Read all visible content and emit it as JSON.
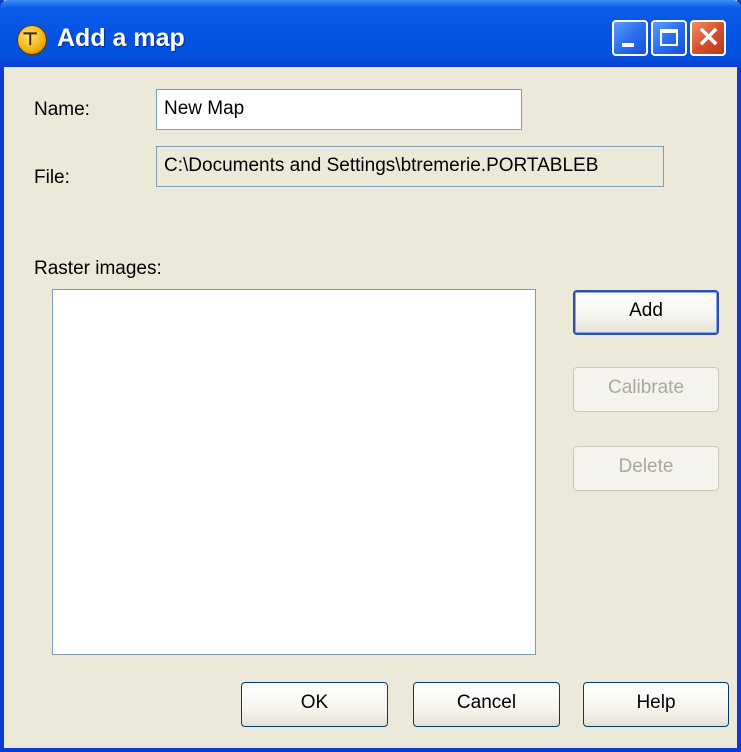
{
  "window": {
    "title": "Add a map",
    "icon": "app-logo-icon"
  },
  "caption_buttons": {
    "minimize": "minimize-icon",
    "maximize": "maximize-icon",
    "close": "close-icon"
  },
  "form": {
    "name_label": "Name:",
    "name_value": "New Map",
    "file_label": "File:",
    "file_value": "C:\\Documents and Settings\\btremerie.PORTABLEB",
    "raster_label": "Raster images:",
    "raster_items": []
  },
  "side_buttons": {
    "add": "Add",
    "calibrate": "Calibrate",
    "delete": "Delete"
  },
  "footer_buttons": {
    "ok": "OK",
    "cancel": "Cancel",
    "help": "Help"
  },
  "colors": {
    "titlebar": "#0a5ce8",
    "dialog_bg": "#ece9d8",
    "close_button": "#d8502c"
  }
}
